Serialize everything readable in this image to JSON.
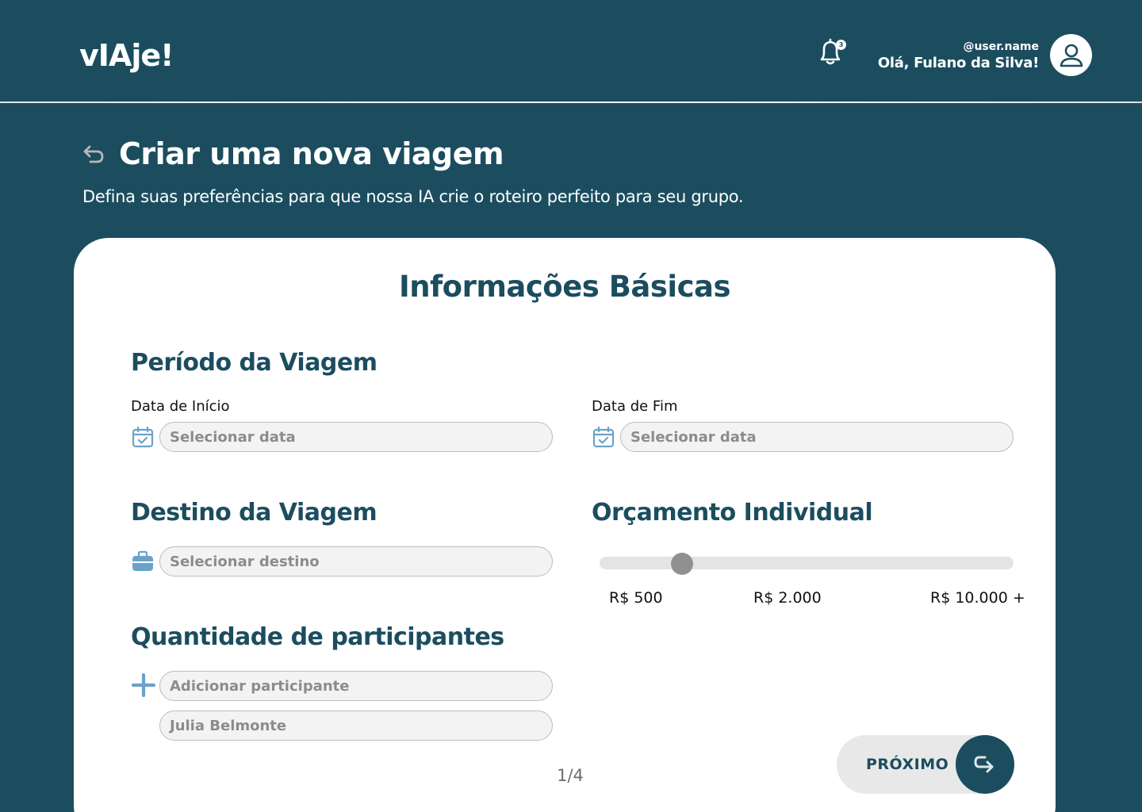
{
  "header": {
    "logo": "vIAje!",
    "notifications_count": "3",
    "user_handle": "@user.name",
    "greeting": "Olá, Fulano da Silva!"
  },
  "page": {
    "title": "Criar uma nova viagem",
    "subtitle": "Defina suas preferências para que nossa IA crie o roteiro perfeito para seu grupo."
  },
  "form": {
    "title": "Informações Básicas",
    "period": {
      "title": "Período da Viagem",
      "start_label": "Data de Início",
      "start_placeholder": "Selecionar data",
      "end_label": "Data de Fim",
      "end_placeholder": "Selecionar data"
    },
    "destination": {
      "title": "Destino da Viagem",
      "placeholder": "Selecionar destino"
    },
    "budget": {
      "title": "Orçamento Individual",
      "min_label": "R$ 500",
      "mid_label": "R$ 2.000",
      "max_label": "R$ 10.000 +",
      "level": 0.2
    },
    "participants": {
      "title": "Quantidade de participantes",
      "add_placeholder": "Adicionar participante",
      "items": [
        "Julia Belmonte"
      ]
    },
    "pager": "1/4",
    "next_label": "PRÓXIMO"
  },
  "colors": {
    "primary": "#1b4d5f",
    "accent_icon": "#6aa3c9",
    "input_bg": "#f3f3f3",
    "slider_thumb": "#909090"
  },
  "icons": {
    "notifications": "bell-icon",
    "avatar": "user-icon",
    "back": "undo-arrow-icon",
    "date": "calendar-check-icon",
    "destination": "suitcase-icon",
    "add": "plus-icon",
    "next": "forward-arrow-icon"
  }
}
